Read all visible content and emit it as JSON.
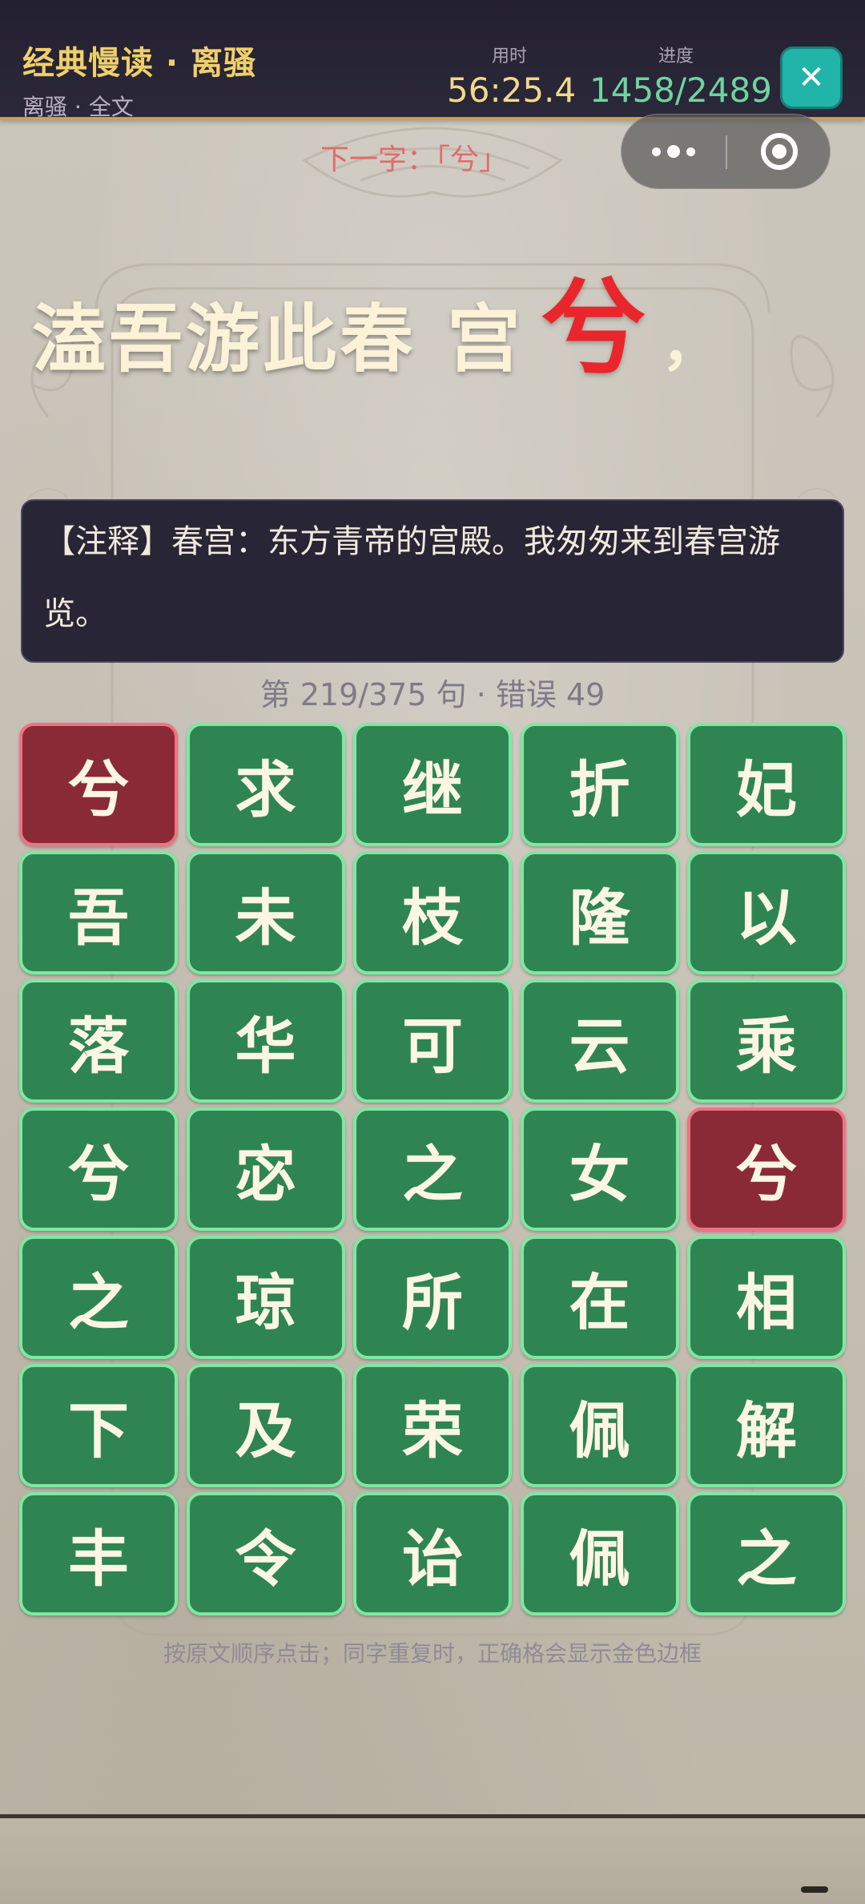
{
  "header": {
    "title": "经典慢读 · 离骚",
    "subtitle": "离骚 · 全文",
    "time_label": "用时",
    "time_value": "56:25.4",
    "progress_label": "进度",
    "progress_value": "1458/2489",
    "close_icon": "close-icon"
  },
  "capsule": {
    "menu_icon": "more-dots-icon",
    "close_icon": "target-circle-icon"
  },
  "hint": {
    "text": "下一字：「兮」"
  },
  "verse": {
    "part1": "溘吾游此春",
    "part2": "宫",
    "current": "兮",
    "punct": "，"
  },
  "note": {
    "text": "【注释】春宫：东方青帝的宫殿。我匆匆来到春宫游览。"
  },
  "counter": {
    "text": "第 219/375 句 · 错误 49"
  },
  "grid": {
    "cells": [
      {
        "char": "兮",
        "state": "wrong"
      },
      {
        "char": "求",
        "state": "normal"
      },
      {
        "char": "继",
        "state": "normal"
      },
      {
        "char": "折",
        "state": "normal"
      },
      {
        "char": "妃",
        "state": "normal"
      },
      {
        "char": "吾",
        "state": "normal"
      },
      {
        "char": "未",
        "state": "normal"
      },
      {
        "char": "枝",
        "state": "normal"
      },
      {
        "char": "隆",
        "state": "normal"
      },
      {
        "char": "以",
        "state": "normal"
      },
      {
        "char": "落",
        "state": "normal"
      },
      {
        "char": "华",
        "state": "normal"
      },
      {
        "char": "可",
        "state": "normal"
      },
      {
        "char": "云",
        "state": "normal"
      },
      {
        "char": "乘",
        "state": "normal"
      },
      {
        "char": "兮",
        "state": "normal"
      },
      {
        "char": "宓",
        "state": "normal"
      },
      {
        "char": "之",
        "state": "normal"
      },
      {
        "char": "女",
        "state": "normal"
      },
      {
        "char": "兮",
        "state": "wrong"
      },
      {
        "char": "之",
        "state": "normal"
      },
      {
        "char": "琼",
        "state": "normal"
      },
      {
        "char": "所",
        "state": "normal"
      },
      {
        "char": "在",
        "state": "normal"
      },
      {
        "char": "相",
        "state": "normal"
      },
      {
        "char": "下",
        "state": "normal"
      },
      {
        "char": "及",
        "state": "normal"
      },
      {
        "char": "荣",
        "state": "normal"
      },
      {
        "char": "佩",
        "state": "normal"
      },
      {
        "char": "解",
        "state": "normal"
      },
      {
        "char": "丰",
        "state": "normal"
      },
      {
        "char": "令",
        "state": "normal"
      },
      {
        "char": "诒",
        "state": "normal"
      },
      {
        "char": "佩",
        "state": "normal"
      },
      {
        "char": "之",
        "state": "normal"
      }
    ]
  },
  "tip": {
    "text": "按原文顺序点击；同字重复时，正确格会显示金色边框"
  },
  "colors": {
    "cell_green": "#2e8552",
    "cell_border_green": "#7ee8a2",
    "cell_wrong": "#8a2a36",
    "cell_border_wrong": "#f07283",
    "accent_gold": "#f0cf6a",
    "current_red": "#e8262b"
  }
}
